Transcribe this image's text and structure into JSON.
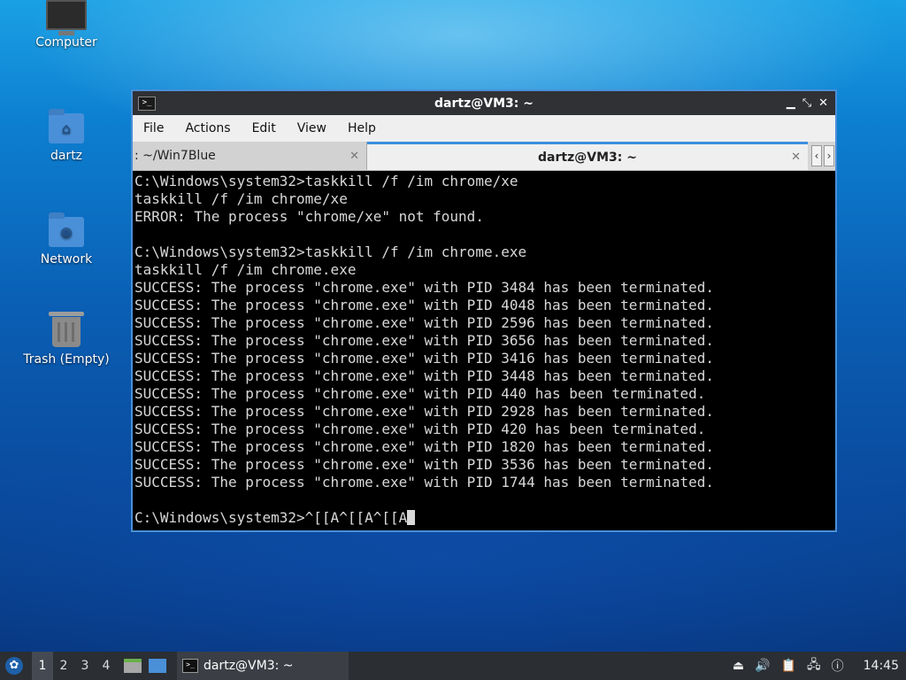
{
  "desktop": {
    "icons": [
      {
        "label": "Computer",
        "icon": "computer-icon"
      },
      {
        "label": "dartz",
        "icon": "home-folder-icon"
      },
      {
        "label": "Network",
        "icon": "network-folder-icon"
      },
      {
        "label": "Trash (Empty)",
        "icon": "trash-icon"
      }
    ]
  },
  "window": {
    "title": "dartz@VM3: ~",
    "menu": [
      "File",
      "Actions",
      "Edit",
      "View",
      "Help"
    ],
    "tabs": [
      {
        "label": ": ~/Win7Blue",
        "active": false
      },
      {
        "label": "dartz@VM3: ~",
        "active": true
      }
    ],
    "terminal_lines": [
      "C:\\Windows\\system32>taskkill /f /im chrome/xe",
      "taskkill /f /im chrome/xe",
      "ERROR: The process \"chrome/xe\" not found.",
      "",
      "C:\\Windows\\system32>taskkill /f /im chrome.exe",
      "taskkill /f /im chrome.exe",
      "SUCCESS: The process \"chrome.exe\" with PID 3484 has been terminated.",
      "SUCCESS: The process \"chrome.exe\" with PID 4048 has been terminated.",
      "SUCCESS: The process \"chrome.exe\" with PID 2596 has been terminated.",
      "SUCCESS: The process \"chrome.exe\" with PID 3656 has been terminated.",
      "SUCCESS: The process \"chrome.exe\" with PID 3416 has been terminated.",
      "SUCCESS: The process \"chrome.exe\" with PID 3448 has been terminated.",
      "SUCCESS: The process \"chrome.exe\" with PID 440 has been terminated.",
      "SUCCESS: The process \"chrome.exe\" with PID 2928 has been terminated.",
      "SUCCESS: The process \"chrome.exe\" with PID 420 has been terminated.",
      "SUCCESS: The process \"chrome.exe\" with PID 1820 has been terminated.",
      "SUCCESS: The process \"chrome.exe\" with PID 3536 has been terminated.",
      "SUCCESS: The process \"chrome.exe\" with PID 1744 has been terminated.",
      ""
    ],
    "prompt_line": "C:\\Windows\\system32>^[[A^[[A^[[A"
  },
  "taskbar": {
    "workspaces": [
      "1",
      "2",
      "3",
      "4"
    ],
    "active_workspace": "1",
    "task_label": "dartz@VM3: ~",
    "clock": "14:45"
  },
  "colors": {
    "accent": "#3b8ee0",
    "terminal_bg": "#000000",
    "terminal_fg": "#d8d8d8"
  }
}
